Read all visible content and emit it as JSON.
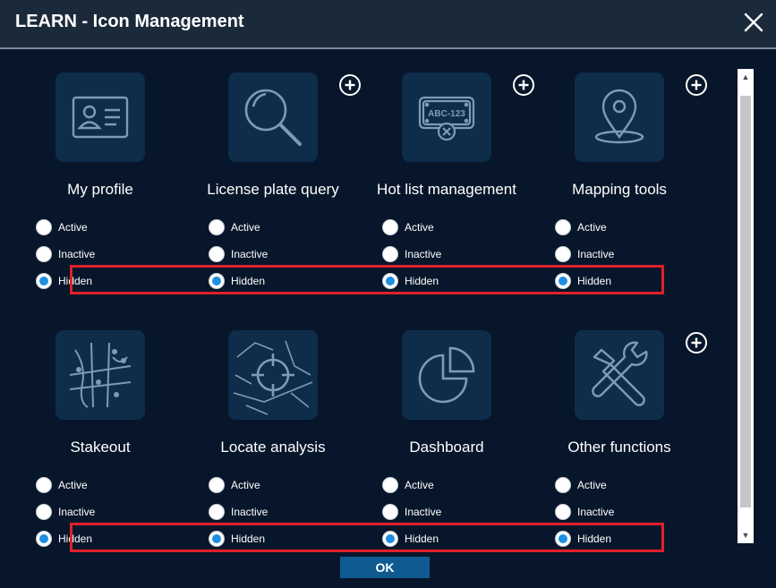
{
  "window": {
    "title": "LEARN - Icon Management"
  },
  "radio_labels": {
    "active": "Active",
    "inactive": "Inactive",
    "hidden": "Hidden"
  },
  "tiles": [
    {
      "label": "My profile",
      "icon": "id-card-icon",
      "selected": "hidden",
      "has_plus": false
    },
    {
      "label": "License plate query",
      "icon": "magnifier-icon",
      "selected": "hidden",
      "has_plus": true
    },
    {
      "label": "Hot list management",
      "icon": "license-plate-icon",
      "plate_text": "ABC-123",
      "selected": "hidden",
      "has_plus": true
    },
    {
      "label": "Mapping tools",
      "icon": "map-pin-icon",
      "selected": "hidden",
      "has_plus": true
    },
    {
      "label": "Stakeout",
      "icon": "street-map-icon",
      "selected": "hidden",
      "has_plus": false
    },
    {
      "label": "Locate analysis",
      "icon": "crosshair-map-icon",
      "selected": "hidden",
      "has_plus": false
    },
    {
      "label": "Dashboard",
      "icon": "pie-chart-icon",
      "selected": "hidden",
      "has_plus": false
    },
    {
      "label": "Other functions",
      "icon": "tools-icon",
      "selected": "hidden",
      "has_plus": true
    }
  ],
  "footer": {
    "ok_label": "OK"
  },
  "colors": {
    "background": "#07162a",
    "titlebar": "#1b2a3b",
    "tile": "#0e2d4b",
    "icon_stroke": "#7f9bb4",
    "radio_selected": "#1e8fe1",
    "highlight_box": "#e0202a",
    "ok_button": "#0f5b91"
  }
}
